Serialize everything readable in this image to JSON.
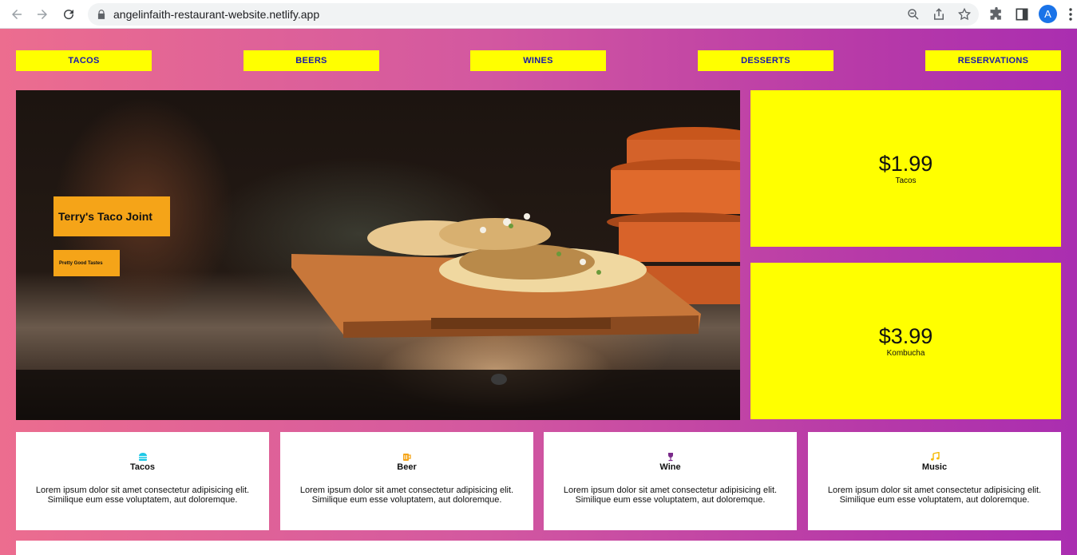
{
  "browser": {
    "url": "angelinfaith-restaurant-website.netlify.app",
    "avatar_letter": "A",
    "icons": [
      "back-icon",
      "forward-icon",
      "reload-icon",
      "lock-icon",
      "zoom-icon",
      "share-icon",
      "bookmark-star-icon",
      "extensions-icon",
      "side-panel-icon",
      "menu-icon"
    ]
  },
  "nav": {
    "items": [
      {
        "label": "TACOS"
      },
      {
        "label": "BEERS"
      },
      {
        "label": "WINES"
      },
      {
        "label": "DESSERTS"
      },
      {
        "label": "RESERVATIONS"
      }
    ]
  },
  "hero": {
    "title": "Terry's Taco Joint",
    "subtitle": "Pretty Good Tastes"
  },
  "prices": [
    {
      "price": "$1.99",
      "label": "Tacos"
    },
    {
      "price": "$3.99",
      "label": "Kombucha"
    }
  ],
  "features": [
    {
      "title": "Tacos",
      "icon": "hamburger-icon",
      "color": "#1ec8e6",
      "text": "Lorem ipsum dolor sit amet consectetur adipisicing elit. Similique eum esse voluptatem, aut doloremque."
    },
    {
      "title": "Beer",
      "icon": "beer-mug-icon",
      "color": "#f5a418",
      "text": "Lorem ipsum dolor sit amet consectetur adipisicing elit. Similique eum esse voluptatem, aut doloremque."
    },
    {
      "title": "Wine",
      "icon": "wine-glass-icon",
      "color": "#7a2a8a",
      "text": "Lorem ipsum dolor sit amet consectetur adipisicing elit. Similique eum esse voluptatem, aut doloremque."
    },
    {
      "title": "Music",
      "icon": "music-note-icon",
      "color": "#f5b800",
      "text": "Lorem ipsum dolor sit amet consectetur adipisicing elit. Similique eum esse voluptatem, aut doloremque."
    }
  ],
  "colors": {
    "nav_bg": "#ffff00",
    "nav_text": "#1a1aaa",
    "hero_label_bg": "#f5a418",
    "price_bg": "#ffff00",
    "gradient_start": "#ec6d8f",
    "gradient_end": "#aa2eb0"
  }
}
